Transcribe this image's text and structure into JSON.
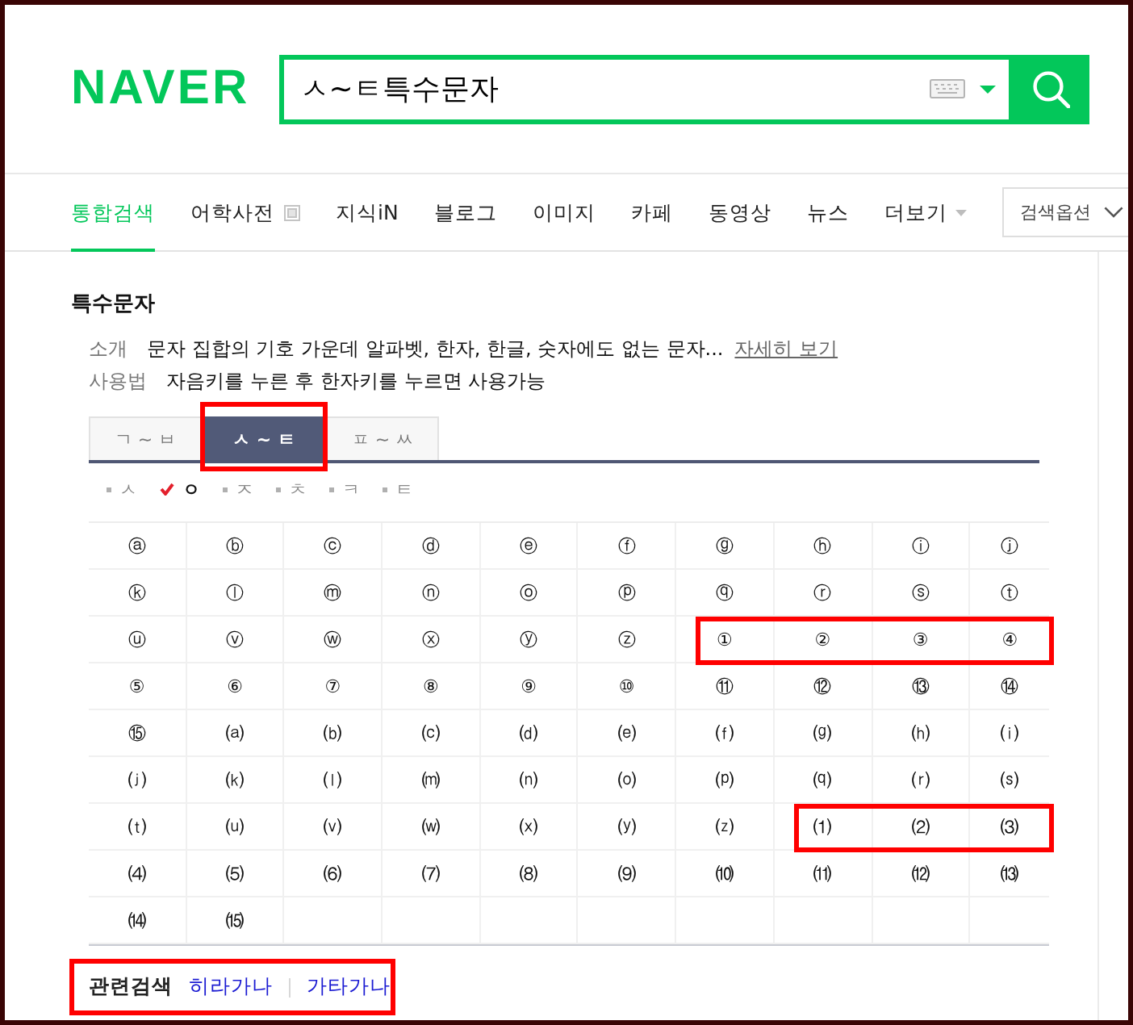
{
  "logo": {
    "text": "NAVER"
  },
  "search": {
    "value": "ㅅ~ㅌ특수문자"
  },
  "nav": {
    "items": [
      {
        "label": "통합검색",
        "selected": true,
        "kind": "plain"
      },
      {
        "label": "어학사전",
        "selected": false,
        "kind": "external"
      },
      {
        "label": "지식iN",
        "selected": false,
        "kind": "plain"
      },
      {
        "label": "블로그",
        "selected": false,
        "kind": "plain"
      },
      {
        "label": "이미지",
        "selected": false,
        "kind": "plain"
      },
      {
        "label": "카페",
        "selected": false,
        "kind": "plain"
      },
      {
        "label": "동영상",
        "selected": false,
        "kind": "plain"
      },
      {
        "label": "뉴스",
        "selected": false,
        "kind": "plain"
      },
      {
        "label": "더보기",
        "selected": false,
        "kind": "menu"
      }
    ],
    "options": {
      "label": "검색옵션"
    }
  },
  "card": {
    "title": "특수문자",
    "info": [
      {
        "label": "소개",
        "text": "문자 집합의 기호 가운데 알파벳, 한자, 한글, 숫자에도 없는 문자...",
        "link": "자세히 보기"
      },
      {
        "label": "사용법",
        "text": "자음키를 누른 후 한자키를 누르면 사용가능"
      }
    ],
    "tabs": [
      {
        "label": "ㄱ ~ ㅂ",
        "selected": false,
        "highlighted": false
      },
      {
        "label": "ㅅ ~ ㅌ",
        "selected": true,
        "highlighted": true
      },
      {
        "label": "ㅍ ~ ㅆ",
        "selected": false,
        "highlighted": false
      }
    ],
    "consonants": [
      {
        "label": "ㅅ",
        "selected": false
      },
      {
        "label": "ㅇ",
        "selected": true
      },
      {
        "label": "ㅈ",
        "selected": false
      },
      {
        "label": "ㅊ",
        "selected": false
      },
      {
        "label": "ㅋ",
        "selected": false
      },
      {
        "label": "ㅌ",
        "selected": false
      }
    ],
    "symbols": [
      {
        "symbol": "ⓐ",
        "highlighted": false
      },
      {
        "symbol": "ⓑ",
        "highlighted": false
      },
      {
        "symbol": "ⓒ",
        "highlighted": false
      },
      {
        "symbol": "ⓓ",
        "highlighted": false
      },
      {
        "symbol": "ⓔ",
        "highlighted": false
      },
      {
        "symbol": "ⓕ",
        "highlighted": false
      },
      {
        "symbol": "ⓖ",
        "highlighted": false
      },
      {
        "symbol": "ⓗ",
        "highlighted": false
      },
      {
        "symbol": "ⓘ",
        "highlighted": false
      },
      {
        "symbol": "ⓙ",
        "highlighted": false
      },
      {
        "symbol": "ⓚ",
        "highlighted": false
      },
      {
        "symbol": "ⓛ",
        "highlighted": false
      },
      {
        "symbol": "ⓜ",
        "highlighted": false
      },
      {
        "symbol": "ⓝ",
        "highlighted": false
      },
      {
        "symbol": "ⓞ",
        "highlighted": false
      },
      {
        "symbol": "ⓟ",
        "highlighted": false
      },
      {
        "symbol": "ⓠ",
        "highlighted": false
      },
      {
        "symbol": "ⓡ",
        "highlighted": false
      },
      {
        "symbol": "ⓢ",
        "highlighted": false
      },
      {
        "symbol": "ⓣ",
        "highlighted": false
      },
      {
        "symbol": "ⓤ",
        "highlighted": false
      },
      {
        "symbol": "ⓥ",
        "highlighted": false
      },
      {
        "symbol": "ⓦ",
        "highlighted": false
      },
      {
        "symbol": "ⓧ",
        "highlighted": false
      },
      {
        "symbol": "ⓨ",
        "highlighted": false
      },
      {
        "symbol": "ⓩ",
        "highlighted": false
      },
      {
        "symbol": "①",
        "highlighted": true
      },
      {
        "symbol": "②",
        "highlighted": true
      },
      {
        "symbol": "③",
        "highlighted": true
      },
      {
        "symbol": "④",
        "highlighted": true
      },
      {
        "symbol": "⑤",
        "highlighted": false
      },
      {
        "symbol": "⑥",
        "highlighted": false
      },
      {
        "symbol": "⑦",
        "highlighted": false
      },
      {
        "symbol": "⑧",
        "highlighted": false
      },
      {
        "symbol": "⑨",
        "highlighted": false
      },
      {
        "symbol": "⑩",
        "highlighted": false
      },
      {
        "symbol": "⑪",
        "highlighted": false
      },
      {
        "symbol": "⑫",
        "highlighted": false
      },
      {
        "symbol": "⑬",
        "highlighted": false
      },
      {
        "symbol": "⑭",
        "highlighted": false
      },
      {
        "symbol": "⑮",
        "highlighted": false
      },
      {
        "symbol": "⒜",
        "highlighted": false
      },
      {
        "symbol": "⒝",
        "highlighted": false
      },
      {
        "symbol": "⒞",
        "highlighted": false
      },
      {
        "symbol": "⒟",
        "highlighted": false
      },
      {
        "symbol": "⒠",
        "highlighted": false
      },
      {
        "symbol": "⒡",
        "highlighted": false
      },
      {
        "symbol": "⒢",
        "highlighted": false
      },
      {
        "symbol": "⒣",
        "highlighted": false
      },
      {
        "symbol": "⒤",
        "highlighted": false
      },
      {
        "symbol": "⒥",
        "highlighted": false
      },
      {
        "symbol": "⒦",
        "highlighted": false
      },
      {
        "symbol": "⒧",
        "highlighted": false
      },
      {
        "symbol": "⒨",
        "highlighted": false
      },
      {
        "symbol": "⒩",
        "highlighted": false
      },
      {
        "symbol": "⒪",
        "highlighted": false
      },
      {
        "symbol": "⒫",
        "highlighted": false
      },
      {
        "symbol": "⒬",
        "highlighted": false
      },
      {
        "symbol": "⒭",
        "highlighted": false
      },
      {
        "symbol": "⒮",
        "highlighted": false
      },
      {
        "symbol": "⒯",
        "highlighted": false
      },
      {
        "symbol": "⒰",
        "highlighted": false
      },
      {
        "symbol": "⒱",
        "highlighted": false
      },
      {
        "symbol": "⒲",
        "highlighted": false
      },
      {
        "symbol": "⒳",
        "highlighted": false
      },
      {
        "symbol": "⒴",
        "highlighted": false
      },
      {
        "symbol": "⒵",
        "highlighted": false
      },
      {
        "symbol": "⑴",
        "highlighted": true
      },
      {
        "symbol": "⑵",
        "highlighted": true
      },
      {
        "symbol": "⑶",
        "highlighted": true
      },
      {
        "symbol": "⑷",
        "highlighted": false
      },
      {
        "symbol": "⑸",
        "highlighted": false
      },
      {
        "symbol": "⑹",
        "highlighted": false
      },
      {
        "symbol": "⑺",
        "highlighted": false
      },
      {
        "symbol": "⑻",
        "highlighted": false
      },
      {
        "symbol": "⑼",
        "highlighted": false
      },
      {
        "symbol": "⑽",
        "highlighted": false
      },
      {
        "symbol": "⑾",
        "highlighted": false
      },
      {
        "symbol": "⑿",
        "highlighted": false
      },
      {
        "symbol": "⒀",
        "highlighted": false
      },
      {
        "symbol": "⒁",
        "highlighted": false
      },
      {
        "symbol": "⒂",
        "highlighted": false
      }
    ],
    "related": {
      "label": "관련검색",
      "highlighted": true,
      "links": [
        "히라가나",
        "가타가나"
      ]
    }
  }
}
